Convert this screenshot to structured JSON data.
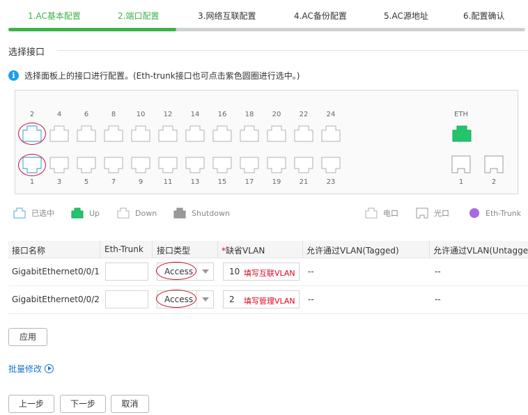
{
  "steps": [
    {
      "label": "1.AC基本配置",
      "state": "done"
    },
    {
      "label": "2.端口配置",
      "state": "current"
    },
    {
      "label": "3.网络互联配置",
      "state": "todo"
    },
    {
      "label": "4.AC备份配置",
      "state": "todo"
    },
    {
      "label": "5.AC源地址",
      "state": "todo"
    },
    {
      "label": "6.配置确认",
      "state": "todo"
    }
  ],
  "progress_fraction": 0.325,
  "section_title": "选择接口",
  "hint": {
    "icon": "info-icon",
    "icon_glyph": "i",
    "text": "选择面板上的接口进行配置。(Eth-trunk接口也可点击紫色圆圈进行选中。)"
  },
  "panel": {
    "top_numbers": [
      "2",
      "4",
      "6",
      "8",
      "10",
      "12",
      "14",
      "16",
      "18",
      "20",
      "22",
      "24"
    ],
    "bottom_numbers": [
      "1",
      "3",
      "5",
      "7",
      "9",
      "11",
      "13",
      "15",
      "17",
      "19",
      "21",
      "23"
    ],
    "selected_ports": [
      "1",
      "2"
    ],
    "eth_label": "ETH",
    "eth_state": "up",
    "optical_numbers": [
      "1",
      "2"
    ]
  },
  "legend": {
    "selected": "已选中",
    "up": "Up",
    "down": "Down",
    "shutdown": "Shutdown",
    "electric": "电口",
    "optical": "光口",
    "eth_trunk": "Eth-Trunk"
  },
  "colors": {
    "accent_green": "#3cb34a",
    "selected_blue": "#6cb8e4",
    "up_green": "#22c46c",
    "shutdown_gray": "#9a9a9a",
    "trunk_purple": "#a56be0",
    "annotation_red": "#c8102e"
  },
  "table": {
    "headers": {
      "name": "接口名称",
      "trunk": "Eth-Trunk",
      "type": "接口类型",
      "vlan_required_mark": "*",
      "vlan": "缺省VLAN",
      "tagged": "允许通过VLAN(Tagged)",
      "untagged": "允许通过VLAN(Untagge"
    },
    "rows": [
      {
        "name": "GigabitEthernet0/0/1",
        "trunk": "",
        "type": "Access",
        "vlan": "10",
        "vlan_note": "填写互联VLAN",
        "tagged": "--",
        "untagged": "--"
      },
      {
        "name": "GigabitEthernet0/0/2",
        "trunk": "",
        "type": "Access",
        "vlan": "2",
        "vlan_note": "填写管理VLAN",
        "tagged": "--",
        "untagged": "--"
      }
    ]
  },
  "apply_label": "应用",
  "batch_label": "批量修改",
  "nav": {
    "prev": "上一步",
    "next": "下一步",
    "cancel": "取消"
  }
}
